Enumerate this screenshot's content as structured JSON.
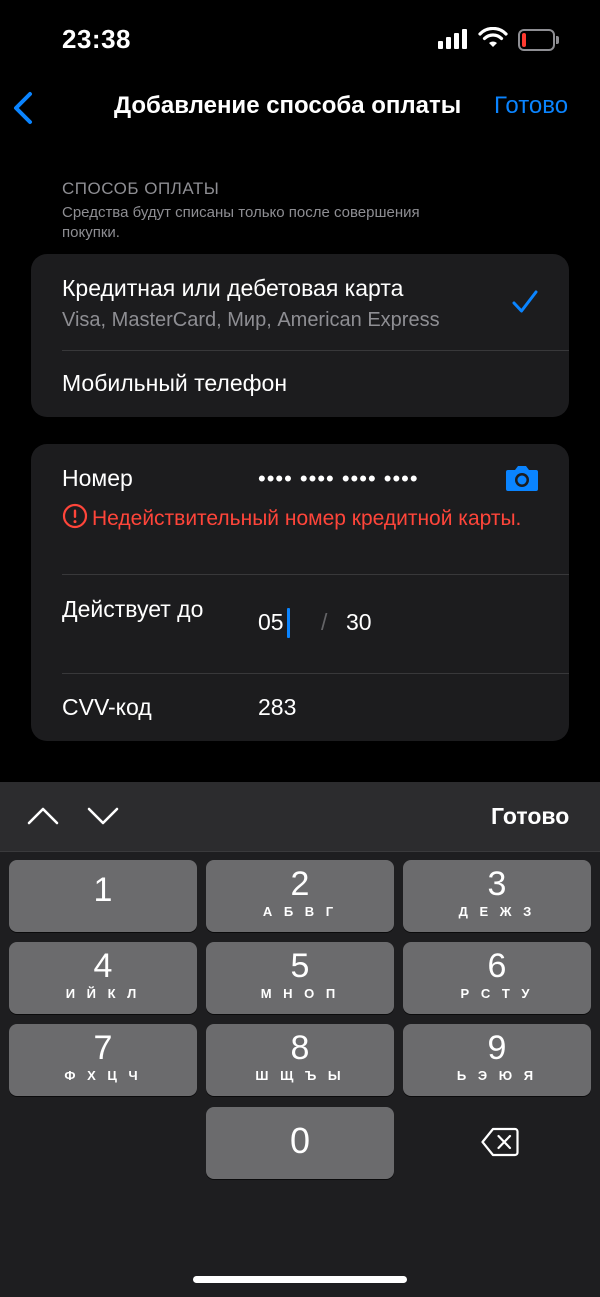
{
  "status_bar": {
    "time": "23:38",
    "signal_icon": "cellular-signal-icon",
    "wifi_icon": "wifi-icon",
    "battery_icon": "battery-low-icon",
    "battery_color": "#ff3b30"
  },
  "nav": {
    "back_icon": "chevron-left-icon",
    "title": "Добавление способа оплаты",
    "done_label": "Готово",
    "accent_color": "#0a84ff"
  },
  "payment_section": {
    "title": "СПОСОБ ОПЛАТЫ",
    "subtitle": "Средства будут списаны только после совершения покупки.",
    "options": [
      {
        "title": "Кредитная или дебетовая карта",
        "subtitle": "Visa, MasterCard, Мир, American Express",
        "selected": true
      },
      {
        "title": "Мобильный телефон",
        "selected": false
      }
    ]
  },
  "card_form": {
    "number_label": "Номер",
    "number_value": "•••• •••• •••• ••••",
    "camera_icon": "camera-icon",
    "error_icon": "exclamation-circle-icon",
    "error_text": "Недействительный номер кредитной карты.",
    "error_color": "#ff453a",
    "expiry_label": "Действует до",
    "expiry_month": "05",
    "expiry_separator": "/",
    "expiry_year": "30",
    "cvv_label": "CVV-код",
    "cvv_value": "283"
  },
  "keyboard": {
    "toolbar": {
      "up_icon": "chevron-up-icon",
      "down_icon": "chevron-down-icon",
      "done_label": "Готово"
    },
    "keys": [
      {
        "digit": "1",
        "letters": ""
      },
      {
        "digit": "2",
        "letters": "А Б В Г"
      },
      {
        "digit": "3",
        "letters": "Д Е Ж З"
      },
      {
        "digit": "4",
        "letters": "И Й К Л"
      },
      {
        "digit": "5",
        "letters": "М Н О П"
      },
      {
        "digit": "6",
        "letters": "Р С Т У"
      },
      {
        "digit": "7",
        "letters": "Ф Х Ц Ч"
      },
      {
        "digit": "8",
        "letters": "Ш Щ Ъ Ы"
      },
      {
        "digit": "9",
        "letters": "Ь Э Ю Я"
      },
      {
        "digit": "0",
        "letters": ""
      }
    ],
    "delete_icon": "backspace-icon"
  }
}
